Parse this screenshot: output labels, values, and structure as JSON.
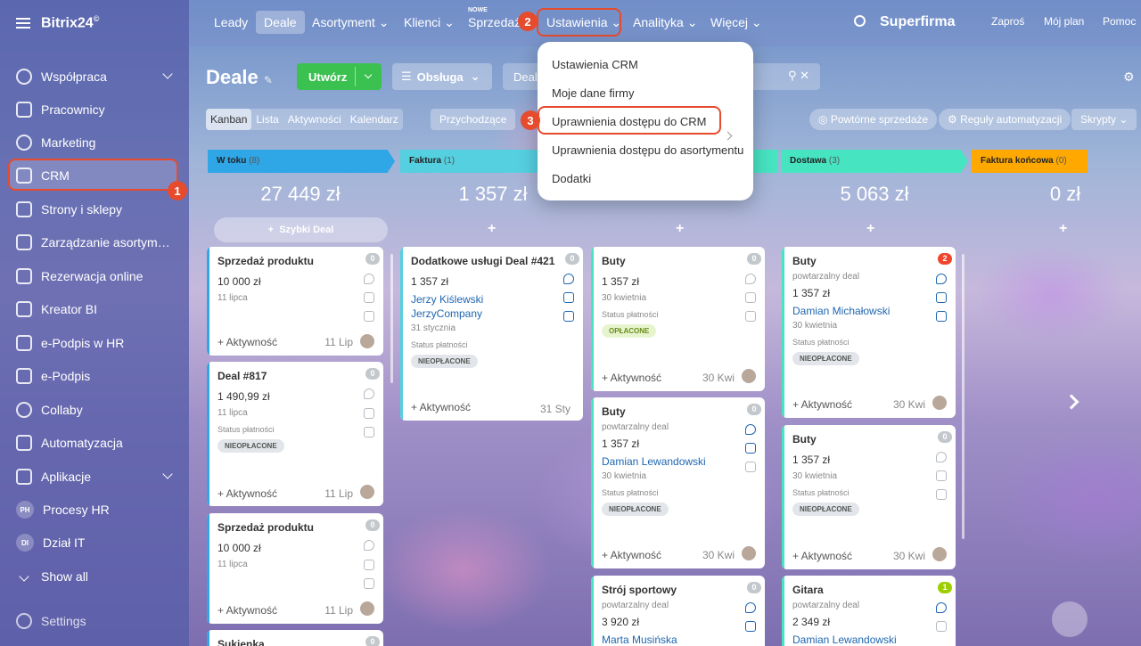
{
  "app": {
    "logo": "Bitrix24",
    "logo_mark": "©"
  },
  "sidebar": {
    "items": [
      {
        "label": "Współpraca"
      },
      {
        "label": "Pracownicy"
      },
      {
        "label": "Marketing"
      },
      {
        "label": "CRM"
      },
      {
        "label": "Strony i sklepy"
      },
      {
        "label": "Zarządzanie asortymen..."
      },
      {
        "label": "Rezerwacja online"
      },
      {
        "label": "Kreator BI"
      },
      {
        "label": "e-Podpis w HR"
      },
      {
        "label": "e-Podpis"
      },
      {
        "label": "Collaby"
      },
      {
        "label": "Automatyzacja"
      },
      {
        "label": "Aplikacje"
      },
      {
        "label": "Procesy HR",
        "initials": "PH"
      },
      {
        "label": "Dział IT",
        "initials": "DI"
      },
      {
        "label": "Show all"
      },
      {
        "label": "Settings"
      }
    ]
  },
  "topnav": {
    "items": [
      "Leady",
      "Deale",
      "Asortyment",
      "Klienci",
      "Sprzedaż",
      "Ustawienia",
      "Analityka",
      "Więcej"
    ],
    "new_badge": "NOWE",
    "company": "Superfirma",
    "links": [
      "Zaproś",
      "Mój plan",
      "Pomoc"
    ]
  },
  "toolbar": {
    "title": "Deale",
    "create": "Utwórz",
    "pipeline": "Obsługa",
    "filter": "Deal"
  },
  "views": {
    "tabs": [
      "Kanban",
      "Lista",
      "Aktywności",
      "Kalendarz"
    ],
    "incoming": "Przychodzące",
    "repeat_sales": "Powtórne sprzedaże",
    "automation": "Reguły automatyzacji",
    "scripts": "Skrypty"
  },
  "menu": {
    "items": [
      "Ustawienia CRM",
      "Moje dane firmy",
      "Uprawnienia dostępu do CRM",
      "Uprawnienia dostępu do asortymentu",
      "Dodatki"
    ]
  },
  "steps": [
    "1",
    "2",
    "3"
  ],
  "columns": [
    {
      "name": "W toku",
      "count": "(8)",
      "sum": "27 449 zł",
      "color": "#2fa6e6"
    },
    {
      "name": "Faktura",
      "count": "(1)",
      "sum": "1 357 zł",
      "color": "#55d0e0"
    },
    {
      "name": "",
      "count": "",
      "sum": "",
      "color": "#47e4c2"
    },
    {
      "name": "Dostawa",
      "count": "(3)",
      "sum": "5 063 zł",
      "color": "#47e4c2"
    },
    {
      "name": "Faktura końcowa",
      "count": "(0)",
      "sum": "0 zł",
      "color": "#ffa900"
    }
  ],
  "quick_deal": "Szybki Deal",
  "common": {
    "activity": "+ Aktywność",
    "payment_status": "Status płatności",
    "unpaid": "NIEOPŁACONE",
    "paid": "OPŁACONE",
    "repeat": "powtarzalny deal"
  },
  "cards": [
    {
      "title": "Sprzedaż produktu",
      "badge": "0",
      "amount": "10 000 zł",
      "date": "11 lipca",
      "adate": "11 Lip"
    },
    {
      "title": "Deal #817",
      "badge": "0",
      "amount": "1 490,99 zł",
      "date": "11 lipca",
      "adate": "11 Lip"
    },
    {
      "title": "Sprzedaż produktu",
      "badge": "0",
      "amount": "10 000 zł",
      "date": "11 lipca",
      "adate": "11 Lip"
    },
    {
      "title": "Sukienka",
      "badge": "0"
    },
    {
      "title": "Dodatkowe usługi Deal #421",
      "badge": "0",
      "amount": "1 357 zł",
      "contact": "Jerzy Kiślewski",
      "company": "JerzyCompany",
      "date": "31 stycznia",
      "adate": "31 Sty"
    },
    {
      "title": "Buty",
      "badge": "0",
      "amount": "1 357 zł",
      "date": "30 kwietnia",
      "adate": "30 Kwi"
    },
    {
      "title": "Buty",
      "badge": "0",
      "amount": "1 357 zł",
      "contact": "Damian Lewandowski",
      "date": "30 kwietnia",
      "adate": "30 Kwi"
    },
    {
      "title": "Strój sportowy",
      "badge": "0",
      "amount": "3 920 zł",
      "contact": "Marta Musińska"
    },
    {
      "title": "Buty",
      "badge": "2",
      "amount": "1 357 zł",
      "contact": "Damian Michałowski",
      "date": "30 kwietnia",
      "adate": "30 Kwi"
    },
    {
      "title": "Buty",
      "badge": "0",
      "amount": "1 357 zł",
      "date": "30 kwietnia",
      "adate": "30 Kwi"
    },
    {
      "title": "Gitara",
      "badge": "1",
      "amount": "2 349 zł",
      "contact": "Damian Lewandowski"
    }
  ]
}
